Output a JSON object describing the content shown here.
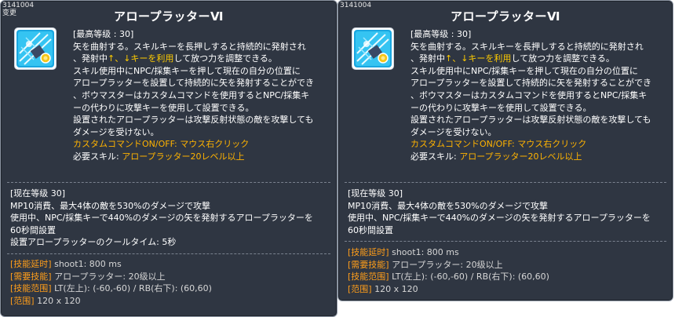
{
  "panels": [
    {
      "skill_id": "3141004",
      "change_label": "变更",
      "title": "アロープラッターⅥ",
      "max_level": "[最高等级 : 30]",
      "desc1": "矢を曲射する。スキルキーを長押しすると持続的に発射され",
      "desc2_pre": "、発射中",
      "desc2_hl": "↑、↓キーを利用",
      "desc2_post": "して放つ力を調整できる。",
      "desc3": "スキル使用中にNPC/採集キーを押して現在の自分の位置に",
      "desc4": "アロープラッターを設置して持続的に矢を発射することができ",
      "desc5": "、ボウマスターはカスタムコマンドを使用するとNPC/採集キ",
      "desc6": "ーの代わりに攻撃キーを使用して設置できる。",
      "desc7": "設置されたアロープラッターは攻撃反射状態の敵を攻撃しても",
      "desc8": "ダメージを受けない。",
      "custom_cmd": "カスタムコマンドON/OFF: マウス右クリック",
      "req_label": "必要スキル: ",
      "req_value": "アロープラッター20レベル以上",
      "cur_header": "[现在等级 30]",
      "cur1": "MP10消費、最大4体の敵を530%のダメージで攻撃",
      "cur2": "使用中、NPC/採集キーで440%のダメージの矢を発射するアロープラッターを",
      "cur3": "60秒間設置",
      "cur4": "設置アロープラッターのクールタイム: 5秒",
      "info": [
        {
          "key": "[技能延时]",
          "val": " shoot1: 800 ms"
        },
        {
          "key": "[需要技能]",
          "val": " アロープラッター: 20级以上"
        },
        {
          "key": "[技能范围]",
          "val": " LT(左上): (-60,-60) / RB(右下): (60,60)"
        },
        {
          "key": "[范围]",
          "val": " 120 x 120"
        }
      ]
    },
    {
      "skill_id": "3141004",
      "title": "アロープラッターⅥ",
      "max_level": "[最高等级 : 30]",
      "desc1": "矢を曲射する。スキルキーを長押しすると持続的に発射され",
      "desc2_pre": "、発射中",
      "desc2_hl": "↑、↓キーを利用",
      "desc2_post": "して放つ力を調整できる。",
      "desc3": "スキル使用中にNPC/採集キーを押して現在の自分の位置に",
      "desc4": "アロープラッターを設置して持続的に矢を発射することができ",
      "desc5": "、ボウマスターはカスタムコマンドを使用するとNPC/採集キ",
      "desc6": "ーの代わりに攻撃キーを使用して設置できる。",
      "desc7": "設置されたアロープラッターは攻撃反射状態の敵を攻撃しても",
      "desc8": "ダメージを受けない。",
      "custom_cmd": "カスタムコマンドON/OFF: マウス右クリック",
      "req_label": "必要スキル: ",
      "req_value": "アロープラッター20レベル以上",
      "cur_header": "[现在等级 30]",
      "cur1": "MP10消費、最大4体の敵を530%のダメージで攻撃",
      "cur2": "使用中、NPC/採集キーで440%のダメージの矢を発射するアロープラッターを",
      "cur3": "60秒間設置",
      "info": [
        {
          "key": "[技能延时]",
          "val": " shoot1: 800 ms"
        },
        {
          "key": "[需要技能]",
          "val": " アロープラッター: 20级以上"
        },
        {
          "key": "[技能范围]",
          "val": " LT(左上): (-60,-60) / RB(右下): (60,60)"
        },
        {
          "key": "[范围]",
          "val": " 120 x 120"
        }
      ]
    }
  ],
  "colors": {
    "panel_bg": "#2f3642",
    "accent": "#ffb300",
    "info_key": "#ff9e1a"
  },
  "icon_name": "arrow-platter-skill-icon"
}
